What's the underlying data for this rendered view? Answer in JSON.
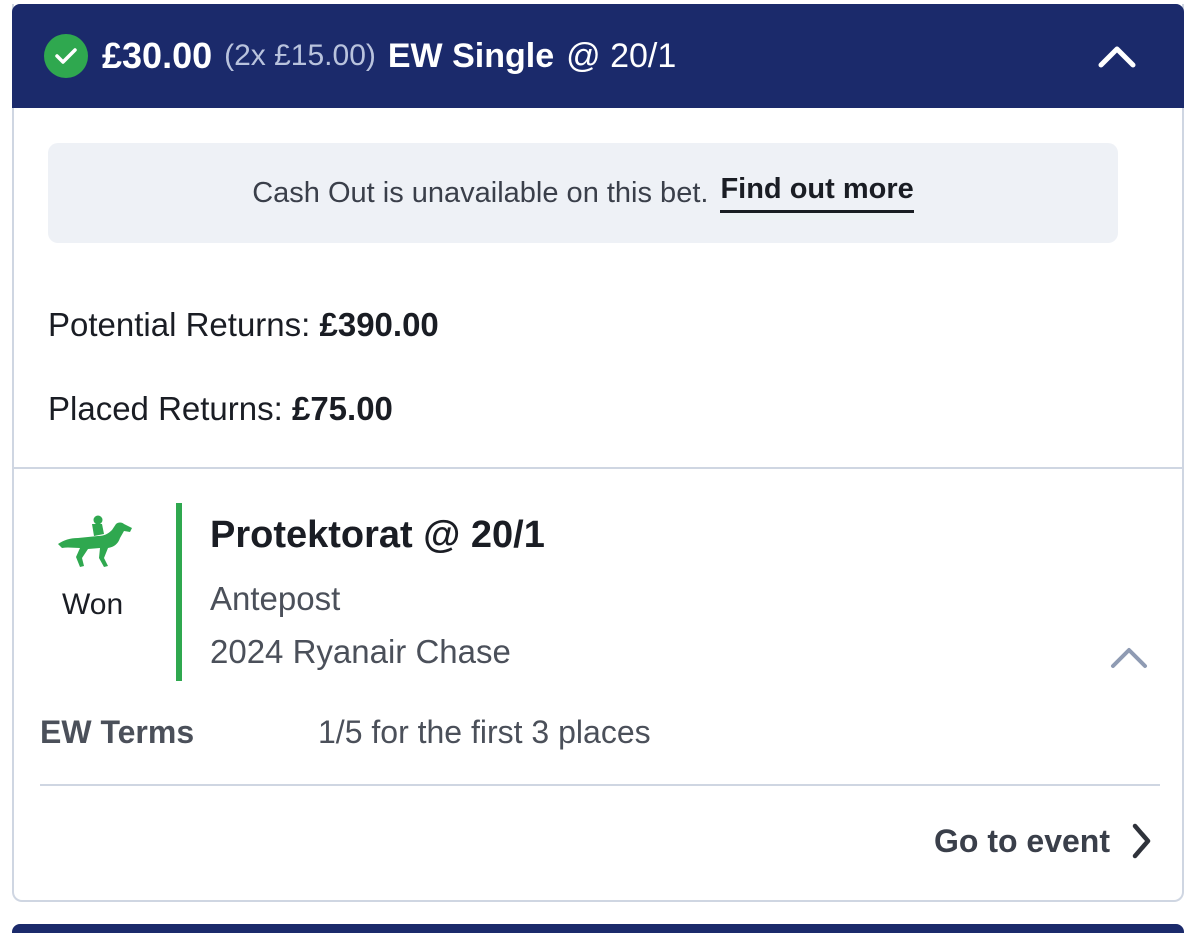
{
  "bet_header": {
    "stake": "£30.00",
    "stake_breakdown": "(2x £15.00)",
    "bet_type": "EW Single",
    "odds": "@ 20/1",
    "status_color": "#2fa84f",
    "background_color": "#1b2a6b"
  },
  "cashout_notice": {
    "message": "Cash Out is unavailable on this bet.",
    "link_label": "Find out more"
  },
  "returns": {
    "potential_label": "Potential Returns:",
    "potential_value": "£390.00",
    "placed_label": "Placed Returns:",
    "placed_value": "£75.00"
  },
  "selection": {
    "icon": "horse-racing-icon",
    "result": "Won",
    "name": "Protektorat @ 20/1",
    "market": "Antepost",
    "event": "2024 Ryanair Chase",
    "result_color": "#2fa84f"
  },
  "ew_terms": {
    "label": "EW Terms",
    "value": "1/5 for the first 3 places"
  },
  "footer": {
    "go_to_event_label": "Go to event"
  }
}
